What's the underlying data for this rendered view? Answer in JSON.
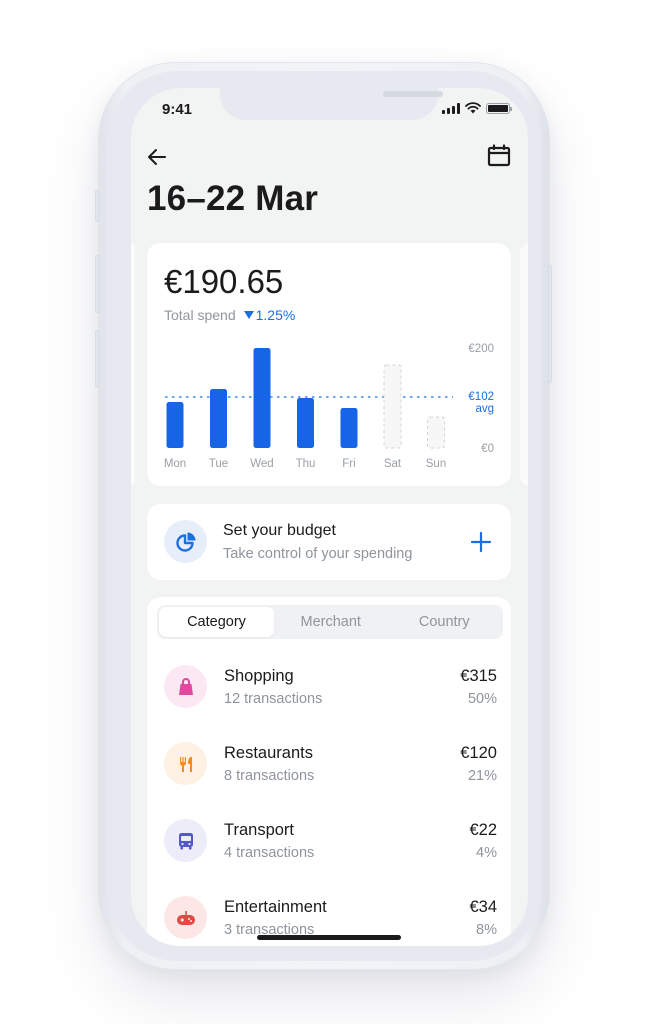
{
  "status_bar": {
    "time": "9:41",
    "icons": [
      "signal-icon",
      "wifi-icon",
      "battery-icon"
    ]
  },
  "header": {
    "back_icon": "arrow-left-icon",
    "calendar_icon": "calendar-icon",
    "title": "16–22 Mar"
  },
  "spend_card": {
    "amount": "€190.65",
    "label": "Total spend",
    "change": "1.25%",
    "change_direction": "down",
    "accent_color": "#1c6fe3"
  },
  "chart_data": {
    "type": "bar",
    "categories": [
      "Mon",
      "Tue",
      "Wed",
      "Thu",
      "Fri",
      "Sat",
      "Sun"
    ],
    "values": [
      92,
      118,
      200,
      100,
      80,
      166,
      62
    ],
    "projected": [
      false,
      false,
      false,
      false,
      false,
      true,
      true
    ],
    "average": 102,
    "average_label": "€102",
    "average_sublabel": "avg",
    "y_tick_labels": [
      "€200",
      "€0"
    ],
    "ylim": [
      0,
      200
    ],
    "title": "",
    "xlabel": "",
    "ylabel": "",
    "bar_color": "#1565e6",
    "grid": false
  },
  "budget": {
    "title": "Set your budget",
    "subtitle": "Take control of your spending",
    "icon": "pie-chart-icon",
    "action_icon": "plus-icon"
  },
  "breakdown": {
    "tabs": [
      {
        "label": "Category",
        "active": true
      },
      {
        "label": "Merchant",
        "active": false
      },
      {
        "label": "Country",
        "active": false
      }
    ],
    "items": [
      {
        "name": "Shopping",
        "transactions": "12 transactions",
        "amount": "€315",
        "percent": "50%",
        "icon": "shopping-bag-icon",
        "color": "#e3489f",
        "bg": "#fce8f3"
      },
      {
        "name": "Restaurants",
        "transactions": "8 transactions",
        "amount": "€120",
        "percent": "21%",
        "icon": "fork-knife-icon",
        "color": "#f08d22",
        "bg": "#fdf1e4"
      },
      {
        "name": "Transport",
        "transactions": "4 transactions",
        "amount": "€22",
        "percent": "4%",
        "icon": "bus-icon",
        "color": "#5558c8",
        "bg": "#ecedf8"
      },
      {
        "name": "Entertainment",
        "transactions": "3 transactions",
        "amount": "€34",
        "percent": "8%",
        "icon": "gamepad-icon",
        "color": "#e04a43",
        "bg": "#fce7e6"
      }
    ]
  }
}
